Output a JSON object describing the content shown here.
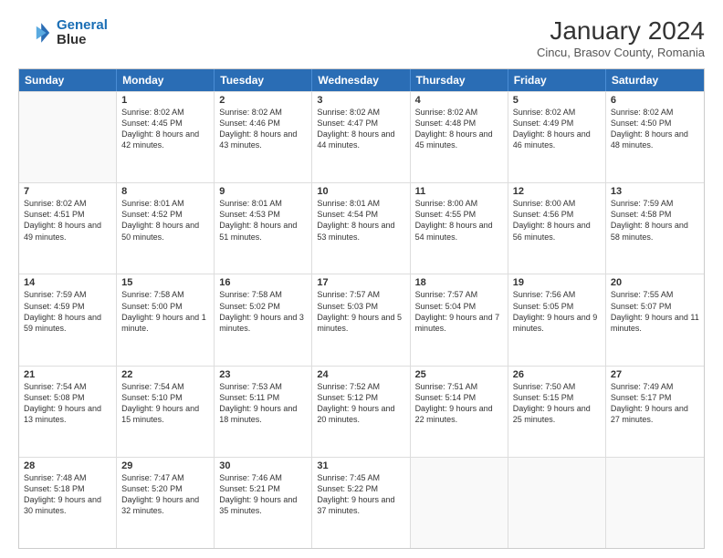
{
  "header": {
    "title": "January 2024",
    "subtitle": "Cincu, Brasov County, Romania",
    "logo_line1": "General",
    "logo_line2": "Blue"
  },
  "weekdays": [
    "Sunday",
    "Monday",
    "Tuesday",
    "Wednesday",
    "Thursday",
    "Friday",
    "Saturday"
  ],
  "rows": [
    [
      {
        "day": "",
        "empty": true
      },
      {
        "day": "1",
        "sunrise": "8:02 AM",
        "sunset": "4:45 PM",
        "daylight": "8 hours and 42 minutes."
      },
      {
        "day": "2",
        "sunrise": "8:02 AM",
        "sunset": "4:46 PM",
        "daylight": "8 hours and 43 minutes."
      },
      {
        "day": "3",
        "sunrise": "8:02 AM",
        "sunset": "4:47 PM",
        "daylight": "8 hours and 44 minutes."
      },
      {
        "day": "4",
        "sunrise": "8:02 AM",
        "sunset": "4:48 PM",
        "daylight": "8 hours and 45 minutes."
      },
      {
        "day": "5",
        "sunrise": "8:02 AM",
        "sunset": "4:49 PM",
        "daylight": "8 hours and 46 minutes."
      },
      {
        "day": "6",
        "sunrise": "8:02 AM",
        "sunset": "4:50 PM",
        "daylight": "8 hours and 48 minutes."
      }
    ],
    [
      {
        "day": "7",
        "sunrise": "8:02 AM",
        "sunset": "4:51 PM",
        "daylight": "8 hours and 49 minutes."
      },
      {
        "day": "8",
        "sunrise": "8:01 AM",
        "sunset": "4:52 PM",
        "daylight": "8 hours and 50 minutes."
      },
      {
        "day": "9",
        "sunrise": "8:01 AM",
        "sunset": "4:53 PM",
        "daylight": "8 hours and 51 minutes."
      },
      {
        "day": "10",
        "sunrise": "8:01 AM",
        "sunset": "4:54 PM",
        "daylight": "8 hours and 53 minutes."
      },
      {
        "day": "11",
        "sunrise": "8:00 AM",
        "sunset": "4:55 PM",
        "daylight": "8 hours and 54 minutes."
      },
      {
        "day": "12",
        "sunrise": "8:00 AM",
        "sunset": "4:56 PM",
        "daylight": "8 hours and 56 minutes."
      },
      {
        "day": "13",
        "sunrise": "7:59 AM",
        "sunset": "4:58 PM",
        "daylight": "8 hours and 58 minutes."
      }
    ],
    [
      {
        "day": "14",
        "sunrise": "7:59 AM",
        "sunset": "4:59 PM",
        "daylight": "8 hours and 59 minutes."
      },
      {
        "day": "15",
        "sunrise": "7:58 AM",
        "sunset": "5:00 PM",
        "daylight": "9 hours and 1 minute."
      },
      {
        "day": "16",
        "sunrise": "7:58 AM",
        "sunset": "5:02 PM",
        "daylight": "9 hours and 3 minutes."
      },
      {
        "day": "17",
        "sunrise": "7:57 AM",
        "sunset": "5:03 PM",
        "daylight": "9 hours and 5 minutes."
      },
      {
        "day": "18",
        "sunrise": "7:57 AM",
        "sunset": "5:04 PM",
        "daylight": "9 hours and 7 minutes."
      },
      {
        "day": "19",
        "sunrise": "7:56 AM",
        "sunset": "5:05 PM",
        "daylight": "9 hours and 9 minutes."
      },
      {
        "day": "20",
        "sunrise": "7:55 AM",
        "sunset": "5:07 PM",
        "daylight": "9 hours and 11 minutes."
      }
    ],
    [
      {
        "day": "21",
        "sunrise": "7:54 AM",
        "sunset": "5:08 PM",
        "daylight": "9 hours and 13 minutes."
      },
      {
        "day": "22",
        "sunrise": "7:54 AM",
        "sunset": "5:10 PM",
        "daylight": "9 hours and 15 minutes."
      },
      {
        "day": "23",
        "sunrise": "7:53 AM",
        "sunset": "5:11 PM",
        "daylight": "9 hours and 18 minutes."
      },
      {
        "day": "24",
        "sunrise": "7:52 AM",
        "sunset": "5:12 PM",
        "daylight": "9 hours and 20 minutes."
      },
      {
        "day": "25",
        "sunrise": "7:51 AM",
        "sunset": "5:14 PM",
        "daylight": "9 hours and 22 minutes."
      },
      {
        "day": "26",
        "sunrise": "7:50 AM",
        "sunset": "5:15 PM",
        "daylight": "9 hours and 25 minutes."
      },
      {
        "day": "27",
        "sunrise": "7:49 AM",
        "sunset": "5:17 PM",
        "daylight": "9 hours and 27 minutes."
      }
    ],
    [
      {
        "day": "28",
        "sunrise": "7:48 AM",
        "sunset": "5:18 PM",
        "daylight": "9 hours and 30 minutes."
      },
      {
        "day": "29",
        "sunrise": "7:47 AM",
        "sunset": "5:20 PM",
        "daylight": "9 hours and 32 minutes."
      },
      {
        "day": "30",
        "sunrise": "7:46 AM",
        "sunset": "5:21 PM",
        "daylight": "9 hours and 35 minutes."
      },
      {
        "day": "31",
        "sunrise": "7:45 AM",
        "sunset": "5:22 PM",
        "daylight": "9 hours and 37 minutes."
      },
      {
        "day": "",
        "empty": true
      },
      {
        "day": "",
        "empty": true
      },
      {
        "day": "",
        "empty": true
      }
    ]
  ],
  "labels": {
    "sunrise": "Sunrise:",
    "sunset": "Sunset:",
    "daylight": "Daylight:"
  }
}
